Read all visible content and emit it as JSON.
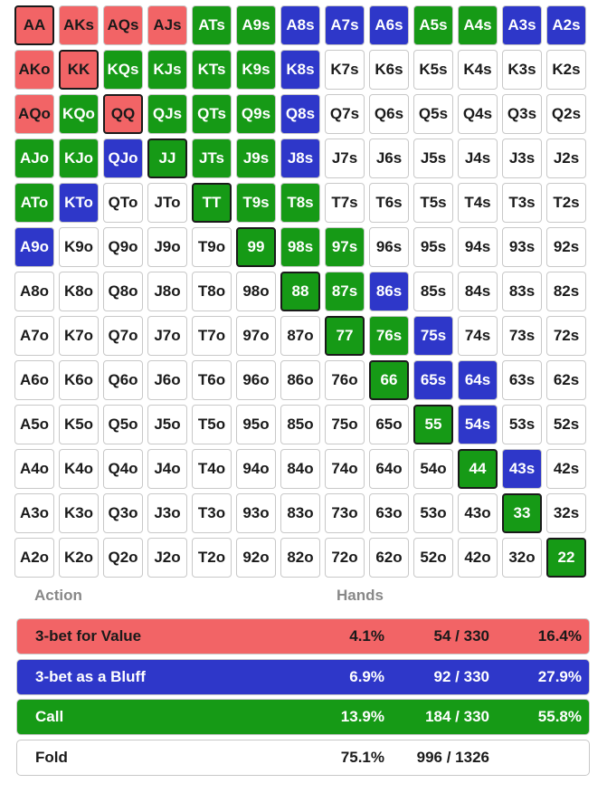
{
  "colors": {
    "value": "#f26466",
    "bluff": "#2e37c9",
    "call": "#169a16",
    "fold": "#ffffff"
  },
  "headers": {
    "action": "Action",
    "hands": "Hands"
  },
  "ranks": [
    "A",
    "K",
    "Q",
    "J",
    "T",
    "9",
    "8",
    "7",
    "6",
    "5",
    "4",
    "3",
    "2"
  ],
  "grid": [
    [
      "V",
      "V",
      "V",
      "V",
      "C",
      "C",
      "B",
      "B",
      "B",
      "C",
      "C",
      "B",
      "B"
    ],
    [
      "V",
      "V",
      "C",
      "C",
      "C",
      "C",
      "B",
      "F",
      "F",
      "F",
      "F",
      "F",
      "F"
    ],
    [
      "V",
      "C",
      "V",
      "C",
      "C",
      "C",
      "B",
      "F",
      "F",
      "F",
      "F",
      "F",
      "F"
    ],
    [
      "C",
      "C",
      "B",
      "C",
      "C",
      "C",
      "B",
      "F",
      "F",
      "F",
      "F",
      "F",
      "F"
    ],
    [
      "C",
      "B",
      "F",
      "F",
      "C",
      "C",
      "C",
      "F",
      "F",
      "F",
      "F",
      "F",
      "F"
    ],
    [
      "B",
      "F",
      "F",
      "F",
      "F",
      "C",
      "C",
      "C",
      "F",
      "F",
      "F",
      "F",
      "F"
    ],
    [
      "F",
      "F",
      "F",
      "F",
      "F",
      "F",
      "C",
      "C",
      "B",
      "F",
      "F",
      "F",
      "F"
    ],
    [
      "F",
      "F",
      "F",
      "F",
      "F",
      "F",
      "F",
      "C",
      "C",
      "B",
      "F",
      "F",
      "F"
    ],
    [
      "F",
      "F",
      "F",
      "F",
      "F",
      "F",
      "F",
      "F",
      "C",
      "B",
      "B",
      "F",
      "F"
    ],
    [
      "F",
      "F",
      "F",
      "F",
      "F",
      "F",
      "F",
      "F",
      "F",
      "C",
      "B",
      "F",
      "F"
    ],
    [
      "F",
      "F",
      "F",
      "F",
      "F",
      "F",
      "F",
      "F",
      "F",
      "F",
      "C",
      "B",
      "F"
    ],
    [
      "F",
      "F",
      "F",
      "F",
      "F",
      "F",
      "F",
      "F",
      "F",
      "F",
      "F",
      "C",
      "F"
    ],
    [
      "F",
      "F",
      "F",
      "F",
      "F",
      "F",
      "F",
      "F",
      "F",
      "F",
      "F",
      "F",
      "C"
    ]
  ],
  "summary": [
    {
      "key": "value",
      "label": "3-bet for Value",
      "pct": "4.1%",
      "count": "54 / 330",
      "share": "16.4%"
    },
    {
      "key": "bluff",
      "label": "3-bet as a Bluff",
      "pct": "6.9%",
      "count": "92 / 330",
      "share": "27.9%"
    },
    {
      "key": "call",
      "label": "Call",
      "pct": "13.9%",
      "count": "184 / 330",
      "share": "55.8%"
    },
    {
      "key": "fold",
      "label": "Fold",
      "pct": "75.1%",
      "count": "996 / 1326",
      "share": ""
    }
  ]
}
